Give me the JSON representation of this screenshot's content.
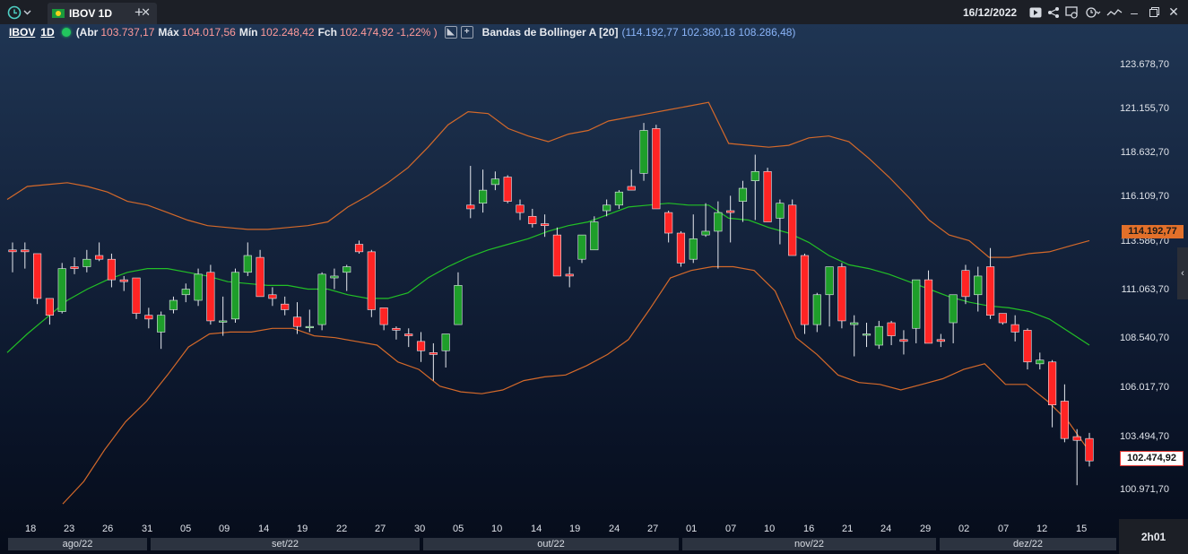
{
  "tab": {
    "title": "IBOV 1D"
  },
  "window": {
    "date": "16/12/2022"
  },
  "info": {
    "symbol": "IBOV",
    "interval": "1D",
    "abr_label": "(Abr",
    "abr": "103.737,17",
    "max_label": "Máx",
    "max": "104.017,56",
    "min_label": "Mín",
    "min": "102.248,42",
    "fch_label": "Fch",
    "fch": "102.474,92 -1,22% )",
    "bb_name": "Bandas de Bollinger A [20]",
    "bb_values": "(114.192,77   102.380,18 108.286,48)"
  },
  "price_axis": {
    "labels": [
      "123.678,70",
      "121.155,70",
      "118.632,70",
      "116.109,70",
      "113.586,70",
      "111.063,70",
      "108.540,70",
      "106.017,70",
      "103.494,70",
      "100.971,70"
    ],
    "bb_tag": "114.192,77",
    "last_tag": "102.474,92"
  },
  "x_axis": {
    "days": [
      "18",
      "23",
      "26",
      "31",
      "05",
      "09",
      "14",
      "19",
      "22",
      "27",
      "30",
      "05",
      "10",
      "14",
      "19",
      "24",
      "27",
      "01",
      "07",
      "10",
      "16",
      "21",
      "24",
      "29",
      "02",
      "07",
      "12",
      "15"
    ],
    "months": [
      "ago/22",
      "set/22",
      "out/22",
      "nov/22",
      "dez/22"
    ]
  },
  "time_remaining": "2h01",
  "colors": {
    "up": "#1e9e2a",
    "down": "#ff2424",
    "band": "#d4692a",
    "mid": "#22c026"
  },
  "chart_data": {
    "type": "candlestick",
    "symbol": "IBOV",
    "interval": "1D",
    "y_ticks": [
      123678.7,
      121155.7,
      118632.7,
      116109.7,
      113586.7,
      111063.7,
      108540.7,
      106017.7,
      103494.7,
      100971.7
    ],
    "candles": [
      {
        "o": 113800,
        "h": 114200,
        "l": 112600,
        "c": 113700
      },
      {
        "o": 113800,
        "h": 114200,
        "l": 112800,
        "c": 113700
      },
      {
        "o": 113600,
        "h": 113600,
        "l": 110900,
        "c": 111200
      },
      {
        "o": 111200,
        "h": 111200,
        "l": 109800,
        "c": 110300
      },
      {
        "o": 110500,
        "h": 113100,
        "l": 110400,
        "c": 112800
      },
      {
        "o": 112900,
        "h": 113400,
        "l": 112500,
        "c": 112800
      },
      {
        "o": 112900,
        "h": 113800,
        "l": 112600,
        "c": 113300
      },
      {
        "o": 113500,
        "h": 114200,
        "l": 113200,
        "c": 113300
      },
      {
        "o": 113300,
        "h": 113600,
        "l": 111800,
        "c": 112200
      },
      {
        "o": 112200,
        "h": 112400,
        "l": 111600,
        "c": 112100
      },
      {
        "o": 112300,
        "h": 112300,
        "l": 110100,
        "c": 110400
      },
      {
        "o": 110300,
        "h": 110700,
        "l": 109600,
        "c": 110100
      },
      {
        "o": 109400,
        "h": 110500,
        "l": 108500,
        "c": 110300
      },
      {
        "o": 110600,
        "h": 111300,
        "l": 110400,
        "c": 111100
      },
      {
        "o": 111400,
        "h": 112000,
        "l": 111000,
        "c": 111700
      },
      {
        "o": 111100,
        "h": 112800,
        "l": 110800,
        "c": 112500
      },
      {
        "o": 112600,
        "h": 113000,
        "l": 109800,
        "c": 110000
      },
      {
        "o": 110000,
        "h": 111300,
        "l": 109200,
        "c": 110000
      },
      {
        "o": 110100,
        "h": 112800,
        "l": 109900,
        "c": 112600
      },
      {
        "o": 112600,
        "h": 114200,
        "l": 112400,
        "c": 113500
      },
      {
        "o": 113400,
        "h": 113800,
        "l": 112200,
        "c": 111300
      },
      {
        "o": 111400,
        "h": 111800,
        "l": 110800,
        "c": 111200
      },
      {
        "o": 110900,
        "h": 111300,
        "l": 110300,
        "c": 110600
      },
      {
        "o": 110200,
        "h": 111000,
        "l": 109300,
        "c": 109700
      },
      {
        "o": 109700,
        "h": 110600,
        "l": 109400,
        "c": 109700
      },
      {
        "o": 109800,
        "h": 112600,
        "l": 109500,
        "c": 112500
      },
      {
        "o": 112300,
        "h": 112800,
        "l": 111700,
        "c": 112400
      },
      {
        "o": 112600,
        "h": 113000,
        "l": 111600,
        "c": 112900
      },
      {
        "o": 114100,
        "h": 114300,
        "l": 113600,
        "c": 113700
      },
      {
        "o": 113700,
        "h": 113800,
        "l": 110200,
        "c": 110600
      },
      {
        "o": 110700,
        "h": 110700,
        "l": 109500,
        "c": 109800
      },
      {
        "o": 109600,
        "h": 109700,
        "l": 109000,
        "c": 109500
      },
      {
        "o": 109300,
        "h": 109600,
        "l": 108600,
        "c": 109200
      },
      {
        "o": 108900,
        "h": 109400,
        "l": 107800,
        "c": 108400
      },
      {
        "o": 108300,
        "h": 108800,
        "l": 106800,
        "c": 108200
      },
      {
        "o": 108400,
        "h": 109000,
        "l": 107500,
        "c": 109300
      },
      {
        "o": 109800,
        "h": 112600,
        "l": 109800,
        "c": 111900
      },
      {
        "o": 116200,
        "h": 118300,
        "l": 115500,
        "c": 116000
      },
      {
        "o": 116300,
        "h": 118100,
        "l": 115800,
        "c": 117000
      },
      {
        "o": 117300,
        "h": 118000,
        "l": 117000,
        "c": 117600
      },
      {
        "o": 117700,
        "h": 117800,
        "l": 116300,
        "c": 116400
      },
      {
        "o": 116200,
        "h": 116500,
        "l": 115400,
        "c": 115800
      },
      {
        "o": 115600,
        "h": 116000,
        "l": 115000,
        "c": 115200
      },
      {
        "o": 115200,
        "h": 115700,
        "l": 114500,
        "c": 115100
      },
      {
        "o": 114600,
        "h": 115000,
        "l": 112700,
        "c": 112400
      },
      {
        "o": 112500,
        "h": 112900,
        "l": 111800,
        "c": 112400
      },
      {
        "o": 113300,
        "h": 114500,
        "l": 113100,
        "c": 114600
      },
      {
        "o": 113800,
        "h": 115600,
        "l": 113800,
        "c": 115300
      },
      {
        "o": 115900,
        "h": 116500,
        "l": 115600,
        "c": 116200
      },
      {
        "o": 116200,
        "h": 117000,
        "l": 116000,
        "c": 116900
      },
      {
        "o": 117200,
        "h": 118100,
        "l": 117000,
        "c": 117000
      },
      {
        "o": 117900,
        "h": 120600,
        "l": 117500,
        "c": 120200
      },
      {
        "o": 120300,
        "h": 120500,
        "l": 116000,
        "c": 116000
      },
      {
        "o": 115800,
        "h": 115900,
        "l": 114200,
        "c": 114700
      },
      {
        "o": 114700,
        "h": 114800,
        "l": 112900,
        "c": 113100
      },
      {
        "o": 113300,
        "h": 115700,
        "l": 113100,
        "c": 114400
      },
      {
        "o": 114600,
        "h": 116300,
        "l": 114500,
        "c": 114800
      },
      {
        "o": 114800,
        "h": 116400,
        "l": 112800,
        "c": 115800
      },
      {
        "o": 115900,
        "h": 116700,
        "l": 114200,
        "c": 115800
      },
      {
        "o": 116400,
        "h": 117500,
        "l": 115300,
        "c": 117100
      },
      {
        "o": 117500,
        "h": 118900,
        "l": 115400,
        "c": 118000
      },
      {
        "o": 118000,
        "h": 118200,
        "l": 115600,
        "c": 115300
      },
      {
        "o": 115500,
        "h": 116500,
        "l": 114100,
        "c": 116300
      },
      {
        "o": 116200,
        "h": 116500,
        "l": 113600,
        "c": 113500
      },
      {
        "o": 113500,
        "h": 113600,
        "l": 109300,
        "c": 109800
      },
      {
        "o": 109800,
        "h": 111500,
        "l": 109400,
        "c": 111400
      },
      {
        "o": 111400,
        "h": 112800,
        "l": 109700,
        "c": 112900
      },
      {
        "o": 112900,
        "h": 113100,
        "l": 109600,
        "c": 110000
      },
      {
        "o": 109800,
        "h": 110300,
        "l": 108100,
        "c": 109900
      },
      {
        "o": 109300,
        "h": 109900,
        "l": 108600,
        "c": 109300
      },
      {
        "o": 108700,
        "h": 110000,
        "l": 108500,
        "c": 109700
      },
      {
        "o": 109900,
        "h": 110000,
        "l": 108700,
        "c": 109200
      },
      {
        "o": 109000,
        "h": 109500,
        "l": 108200,
        "c": 108900
      },
      {
        "o": 109600,
        "h": 110400,
        "l": 108800,
        "c": 112200
      },
      {
        "o": 112200,
        "h": 112700,
        "l": 109600,
        "c": 108800
      },
      {
        "o": 109000,
        "h": 109300,
        "l": 108600,
        "c": 108900
      },
      {
        "o": 109900,
        "h": 111100,
        "l": 108800,
        "c": 111400
      },
      {
        "o": 112700,
        "h": 113000,
        "l": 110900,
        "c": 111300
      },
      {
        "o": 111400,
        "h": 112900,
        "l": 110500,
        "c": 112400
      },
      {
        "o": 112900,
        "h": 113900,
        "l": 110100,
        "c": 110300
      },
      {
        "o": 110400,
        "h": 110400,
        "l": 109800,
        "c": 109900
      },
      {
        "o": 109800,
        "h": 110300,
        "l": 108900,
        "c": 109400
      },
      {
        "o": 109500,
        "h": 109600,
        "l": 107400,
        "c": 107800
      },
      {
        "o": 107700,
        "h": 108300,
        "l": 107400,
        "c": 107900
      },
      {
        "o": 107800,
        "h": 107900,
        "l": 104300,
        "c": 105500
      },
      {
        "o": 105700,
        "h": 106600,
        "l": 103500,
        "c": 103700
      },
      {
        "o": 103800,
        "h": 104200,
        "l": 101200,
        "c": 103600
      },
      {
        "o": 103700,
        "h": 104000,
        "l": 102200,
        "c": 102500
      }
    ],
    "bb_upper": [
      116500,
      117200,
      117300,
      117400,
      117200,
      116900,
      116400,
      116200,
      115800,
      115400,
      115100,
      115000,
      114900,
      114900,
      115000,
      115100,
      115300,
      116100,
      116700,
      117400,
      118200,
      119300,
      120500,
      121200,
      121100,
      120300,
      119900,
      119600,
      120000,
      120200,
      120700,
      120900,
      121100,
      121300,
      121500,
      121700,
      119500,
      119400,
      119300,
      119400,
      119800,
      119900,
      119600,
      118700,
      117700,
      116600,
      115400,
      114600,
      114300,
      113400,
      113400,
      113600,
      113700,
      114000,
      114300
    ],
    "bb_middle": [
      108300,
      109300,
      110200,
      111100,
      111700,
      112200,
      112600,
      112800,
      112800,
      112600,
      112400,
      112100,
      112000,
      111900,
      111900,
      111700,
      111700,
      111400,
      111200,
      111200,
      111500,
      112300,
      112900,
      113400,
      113800,
      114100,
      114400,
      114800,
      115100,
      115300,
      115700,
      116100,
      116200,
      116300,
      116200,
      116200,
      115500,
      115400,
      115000,
      114700,
      114200,
      113500,
      113000,
      112800,
      112500,
      112100,
      111700,
      111300,
      111000,
      110800,
      110700,
      110500,
      110100,
      109400,
      108700
    ],
    "bb_lower": [
      100200,
      101400,
      103100,
      104600,
      105700,
      107100,
      108600,
      109300,
      109400,
      109400,
      109600,
      109600,
      109200,
      109100,
      108900,
      108700,
      107800,
      107400,
      106500,
      106200,
      106100,
      106300,
      106800,
      107000,
      107100,
      107600,
      108200,
      109000,
      110600,
      112300,
      112700,
      112900,
      112900,
      112700,
      111600,
      109100,
      108200,
      107100,
      106700,
      106600,
      106300,
      106600,
      106900,
      107400,
      107700,
      106600,
      106600,
      105700,
      104600,
      103000
    ],
    "last_price": 102474.92,
    "bb_last": 114192.77
  }
}
